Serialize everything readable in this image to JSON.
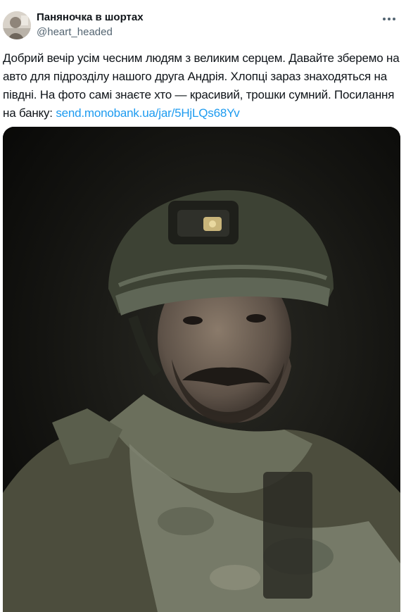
{
  "tweet": {
    "author_name": "Паняночка в шортах",
    "author_handle": "@heart_headed",
    "text_main": "Добрий вечір усім чесним людям з великим серцем. Давайте зберемо на авто для підрозділу нашого друга Андрія. Хлопці зараз знаходяться на півдні. На фото самі знаєте хто — красивий, трошки сумний. Посилання на банку: ",
    "link_text": "send.monobank.ua/jar/5HjLQs68Yv",
    "more_icon": "more-horizontal-icon",
    "media_description_icon": "photo"
  },
  "colors": {
    "text": "#0f1419",
    "secondary": "#536471",
    "link": "#1d9bf0"
  }
}
